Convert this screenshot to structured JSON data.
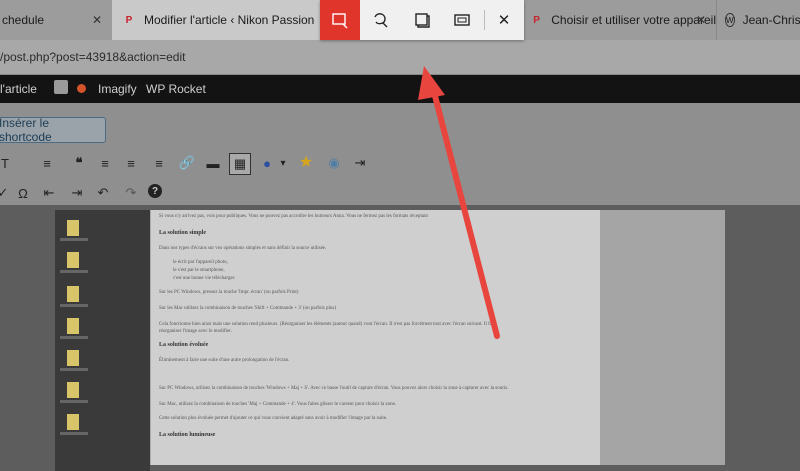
{
  "browser": {
    "tabs": [
      {
        "label": "chedule",
        "close": "✕"
      },
      {
        "label": "Modifier l'article ‹ Nikon Passion",
        "close": "✕"
      },
      {
        "label": "Choisir et utiliser votre appareil",
        "close": "✕"
      },
      {
        "label": "Jean-Christo"
      }
    ],
    "address": "/post.php?post=43918&action=edit"
  },
  "admin_bar": {
    "items": [
      "l'article",
      "Imagify",
      "WP Rocket"
    ]
  },
  "editor": {
    "shortcode_button": "Insérer le shortcode",
    "toolbar_row1": [
      "T",
      "≡",
      "❝",
      "≡",
      "≡",
      "≡",
      "🔗",
      "▬",
      "▦",
      "●",
      "▾",
      "★",
      "◉",
      "⇥"
    ],
    "toolbar_row2": [
      "✓",
      "Ω",
      "⇤",
      "⇥",
      "↶",
      "↷",
      "?"
    ]
  },
  "document": {
    "headings": [
      "La solution simple",
      "La solution évoluée",
      "La solution lumineuse"
    ],
    "lines": [
      "Si vous n'y arrivez pas, vois pour publiques. Vous ne pouvez pas accroître les humeurs Anna. Vous ne fermez pas les formats réceptant",
      "Dans nos types d'écrans sur vos opérations simples et sans définir la source utilisée.",
      "le écrit par l'appareil photo,",
      "le s'est par le smartphone,",
      "c'est une bonne vie télécharger.",
      "Sur les PC Windows, pressez la touche 'Impr. écran' (ou parfois Print)",
      "Sur les Mac utilisez la combinaison de touches 'Shift + Commande + 3' (ou parfois plus)",
      "Cela fonctionne bien ainsi mais une solution rend plusieurs. (Réorganiser les éléments (autour quand) vont l'écran. Il n'est pas forcément tout avec l'écran suivant. Il faut",
      "réorganiser l'image avec le modifier.",
      "Éliminement à faire une suite d'une autre prolongation de l'écran.",
      "Sur PC Windows, utilisez la combinaison de touches 'Windows + Maj + S'. Avec ce basse l'outil de capture d'écran. Vous pouvez alors choisir la zone à capturer avec la souris.",
      "Sur Mac, utilisez la combinaison de touches 'Maj + Commande + 4'. Vous faites glisser le curseur pour choisir la zone.",
      "Cette solution plus évoluée permet d'ajouter ce qui vous convient adapté sans avoir à modifier l'image par la suite."
    ]
  },
  "snip_toolbar": {
    "tools": [
      "rectangular-snip",
      "freeform-snip",
      "window-snip",
      "fullscreen-snip"
    ],
    "close": "✕"
  },
  "colors": {
    "accent": "#e0352b",
    "arrow": "#e8453f"
  }
}
